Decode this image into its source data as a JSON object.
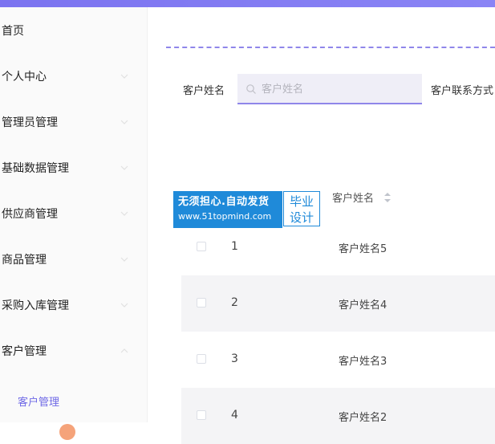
{
  "sidebar": {
    "items": [
      {
        "label": "首页",
        "has_arrow": false
      },
      {
        "label": "个人中心",
        "has_arrow": true
      },
      {
        "label": "管理员管理",
        "has_arrow": true
      },
      {
        "label": "基础数据管理",
        "has_arrow": true
      },
      {
        "label": "供应商管理",
        "has_arrow": true
      },
      {
        "label": "商品管理",
        "has_arrow": true
      },
      {
        "label": "采购入库管理",
        "has_arrow": true
      },
      {
        "label": "客户管理",
        "has_arrow": true,
        "expanded": true
      }
    ],
    "submenu": {
      "label": "客户管理"
    }
  },
  "search": {
    "label": "客户姓名",
    "placeholder": "客户姓名",
    "label2": "客户联系方式"
  },
  "table": {
    "header": {
      "name": "客户姓名"
    },
    "rows": [
      {
        "index": "1",
        "name": "客户姓名5"
      },
      {
        "index": "2",
        "name": "客户姓名4"
      },
      {
        "index": "3",
        "name": "客户姓名3"
      },
      {
        "index": "4",
        "name": "客户姓名2"
      }
    ]
  },
  "watermark": {
    "line1": "无须担心.自动发货",
    "line2": "www.51topmind.com",
    "right1": "毕业",
    "right2": "设计"
  },
  "colors": {
    "accent": "#8f86ea",
    "topbar": "#7b73f0",
    "submenu_active": "#6f69e6",
    "watermark_blue": "#1f8ad9"
  }
}
